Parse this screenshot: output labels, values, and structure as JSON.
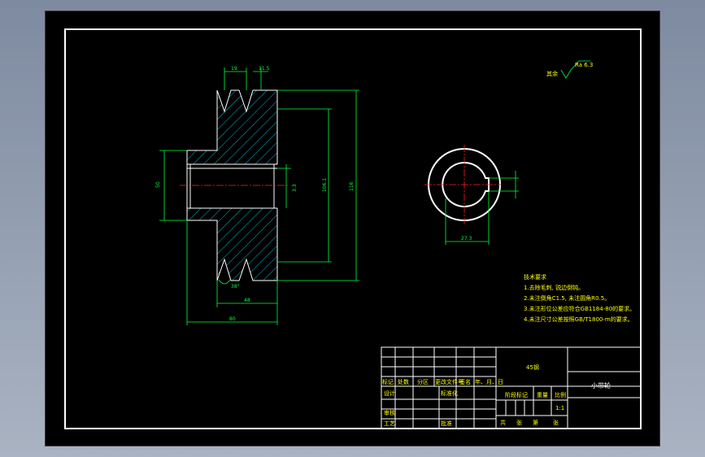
{
  "dimensions": {
    "groove_pitch": "19",
    "groove_width": "11.5",
    "hub_diameter": "50",
    "keyway_depth": "3.3",
    "pitch_diameter": "106.1",
    "outer_diameter": "116",
    "groove_angle": "38°",
    "rim_width": "48",
    "overall_width": "80",
    "key_depth": "27.3"
  },
  "roughness": {
    "label": "其余",
    "value": "Ra 6.3"
  },
  "tech_requirements": {
    "title": "技术要求",
    "items": [
      "1.去除毛刺, 锐边倒钝。",
      "2.未注倒角C1.5, 未注圆角R0.5。",
      "3.未注形位公差应符合GB1184-80的要求。",
      "4.未注尺寸公差按照GB/T1800-m的要求。"
    ]
  },
  "title_block": {
    "material": "45钢",
    "part_name": "小带轮",
    "rev_headers": [
      "标记",
      "处数",
      "分区",
      "更改文件号",
      "签名",
      "年、月、日"
    ],
    "design": "设计",
    "standardize": "标准化",
    "stage_mark": "阶段标记",
    "weight": "重量",
    "scale_label": "比例",
    "scale": "1:1",
    "review": "审核",
    "process": "工艺",
    "approve": "批准",
    "sheet_info": [
      "共",
      "张",
      "第",
      "张"
    ]
  }
}
